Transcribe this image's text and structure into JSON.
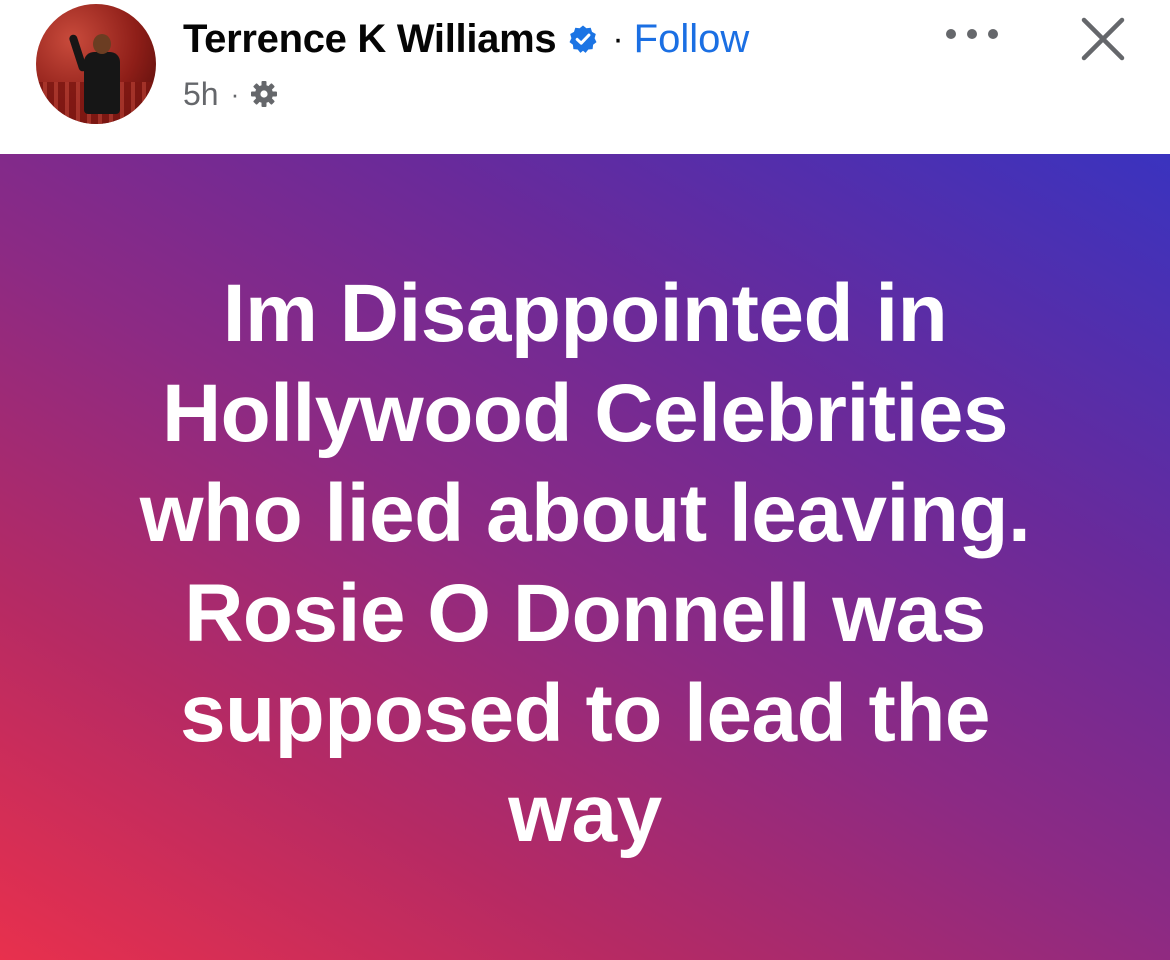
{
  "post": {
    "author": "Terrence K Williams",
    "follow_label": "Follow",
    "separator": "·",
    "timestamp": "5h",
    "meta_separator": "·",
    "verified_color": "#1b74e4",
    "follow_color": "#1b6fe3",
    "icons": {
      "verified": "verified-badge-icon",
      "audience": "gear-icon",
      "more": "more-options-icon",
      "close": "close-icon"
    },
    "body_text": "Im Disappointed in\nHollywood Celebrities\nwho lied about leaving.\nRosie O Donnell was\nsupposed to lead the\nway",
    "background_gradient": [
      "#e8304d",
      "#8c2a84",
      "#3a33bf"
    ],
    "text_color": "#ffffff"
  }
}
